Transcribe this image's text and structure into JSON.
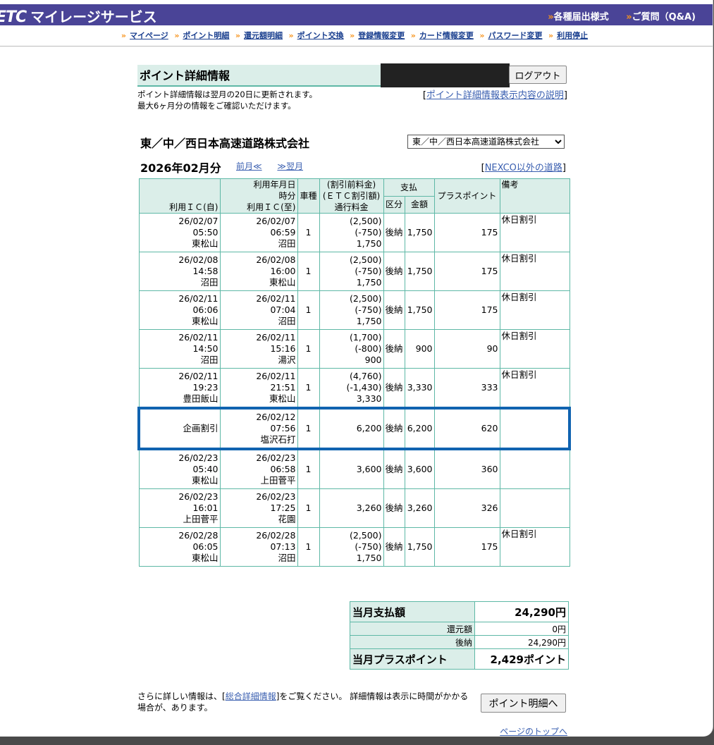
{
  "header": {
    "logo": "ETC",
    "service": "マイレージサービス",
    "links": [
      "各種届出様式",
      "ご質問（Q&A)"
    ]
  },
  "nav": [
    "マイページ",
    "ポイント明細",
    "還元額明細",
    "ポイント交換",
    "登録情報変更",
    "カード情報変更",
    "パスワード変更",
    "利用停止"
  ],
  "page": {
    "title": "ポイント詳細情報",
    "logout": "ログアウト",
    "note1": "ポイント詳細情報は翌月の20日に更新されます。",
    "note2": "最大6ヶ月分の情報をご確認いただけます。",
    "help_link": "ポイント詳細情報表示内容の説明",
    "company": "東／中／西日本高速道路株式会社",
    "company_select": "東／中／西日本高速道路株式会社",
    "month": "2026年02月分",
    "prev": "前月≪",
    "next": "≫翌月",
    "nexco_link": "NEXCO以外の道路"
  },
  "table": {
    "headers": {
      "ic_from": "利用ＩＣ(自)",
      "date_time_1": "利用年月日",
      "date_time_2": "時分",
      "ic_to": "利用ＩＣ(至)",
      "vehicle": "車種",
      "fee_1": "(割引前料金)",
      "fee_2": "(ＥＴＣ割引額)",
      "fee_3": "通行料金",
      "payment": "支払",
      "pay_type": "区分",
      "pay_amount": "金額",
      "plus_point": "プラスポイント",
      "remarks": "備考"
    },
    "rows": [
      {
        "from_date": "26/02/07",
        "from_time": "05:50",
        "from_ic": "東松山",
        "to_date": "26/02/07",
        "to_time": "06:59",
        "to_ic": "沼田",
        "vehicle": "1",
        "fee_before": "(2,500)",
        "discount": "(-750)",
        "fee": "1,750",
        "pay_type": "後納",
        "amount": "1,750",
        "points": "175",
        "remarks": "休日割引"
      },
      {
        "from_date": "26/02/08",
        "from_time": "14:58",
        "from_ic": "沼田",
        "to_date": "26/02/08",
        "to_time": "16:00",
        "to_ic": "東松山",
        "vehicle": "1",
        "fee_before": "(2,500)",
        "discount": "(-750)",
        "fee": "1,750",
        "pay_type": "後納",
        "amount": "1,750",
        "points": "175",
        "remarks": "休日割引"
      },
      {
        "from_date": "26/02/11",
        "from_time": "06:06",
        "from_ic": "東松山",
        "to_date": "26/02/11",
        "to_time": "07:04",
        "to_ic": "沼田",
        "vehicle": "1",
        "fee_before": "(2,500)",
        "discount": "(-750)",
        "fee": "1,750",
        "pay_type": "後納",
        "amount": "1,750",
        "points": "175",
        "remarks": "休日割引"
      },
      {
        "from_date": "26/02/11",
        "from_time": "14:50",
        "from_ic": "沼田",
        "to_date": "26/02/11",
        "to_time": "15:16",
        "to_ic": "湯沢",
        "vehicle": "1",
        "fee_before": "(1,700)",
        "discount": "(-800)",
        "fee": "900",
        "pay_type": "後納",
        "amount": "900",
        "points": "90",
        "remarks": "休日割引"
      },
      {
        "from_date": "26/02/11",
        "from_time": "19:23",
        "from_ic": "豊田飯山",
        "to_date": "26/02/11",
        "to_time": "21:51",
        "to_ic": "東松山",
        "vehicle": "1",
        "fee_before": "(4,760)",
        "discount": "(-1,430)",
        "fee": "3,330",
        "pay_type": "後納",
        "amount": "3,330",
        "points": "333",
        "remarks": "休日割引"
      },
      {
        "from_date": "",
        "from_time": "",
        "from_ic": "企画割引",
        "to_date": "26/02/12",
        "to_time": "07:56",
        "to_ic": "塩沢石打",
        "vehicle": "1",
        "fee_before": "",
        "discount": "",
        "fee": "6,200",
        "pay_type": "後納",
        "amount": "6,200",
        "points": "620",
        "remarks": "",
        "highlight": true
      },
      {
        "from_date": "26/02/23",
        "from_time": "05:40",
        "from_ic": "東松山",
        "to_date": "26/02/23",
        "to_time": "06:58",
        "to_ic": "上田菅平",
        "vehicle": "1",
        "fee_before": "",
        "discount": "",
        "fee": "3,600",
        "pay_type": "後納",
        "amount": "3,600",
        "points": "360",
        "remarks": ""
      },
      {
        "from_date": "26/02/23",
        "from_time": "16:01",
        "from_ic": "上田菅平",
        "to_date": "26/02/23",
        "to_time": "17:25",
        "to_ic": "花園",
        "vehicle": "1",
        "fee_before": "",
        "discount": "",
        "fee": "3,260",
        "pay_type": "後納",
        "amount": "3,260",
        "points": "326",
        "remarks": ""
      },
      {
        "from_date": "26/02/28",
        "from_time": "06:05",
        "from_ic": "東松山",
        "to_date": "26/02/28",
        "to_time": "07:13",
        "to_ic": "沼田",
        "vehicle": "1",
        "fee_before": "(2,500)",
        "discount": "(-750)",
        "fee": "1,750",
        "pay_type": "後納",
        "amount": "1,750",
        "points": "175",
        "remarks": "休日割引"
      }
    ]
  },
  "summary": {
    "pay_label": "当月支払額",
    "pay_value": "24,290円",
    "refund_label": "還元額",
    "refund_value": "0円",
    "deferred_label": "後納",
    "deferred_value": "24,290円",
    "points_label": "当月プラスポイント",
    "points_value": "2,429ポイント"
  },
  "footer": {
    "more_pre": "さらに詳しい情報は、[",
    "more_link": "総合詳細情報",
    "more_post": "]をご覧ください。 詳細情報は表示に時間がかかる場合が、あります。",
    "button": "ポイント明細へ",
    "page_top": "ページのトップへ"
  }
}
